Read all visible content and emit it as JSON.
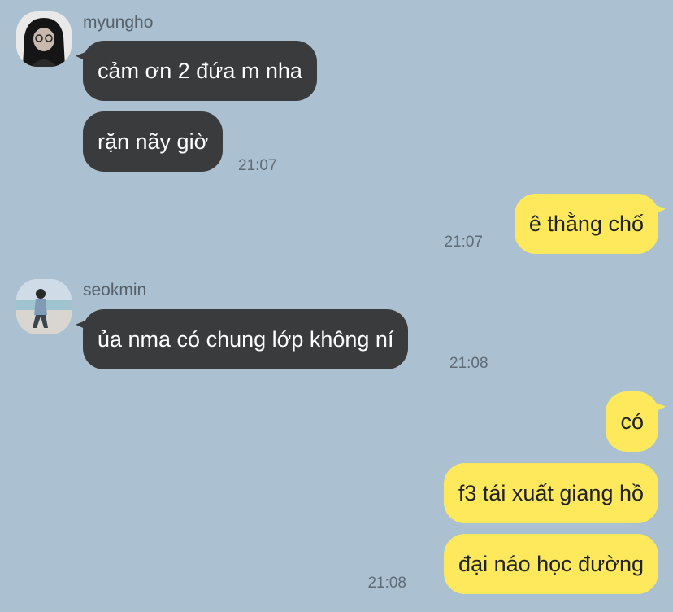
{
  "chat": {
    "messages": [
      {
        "sender": "myungho",
        "text": "cảm ơn 2 đứa m nha"
      },
      {
        "sender": "myungho",
        "text": "rặn nãy giờ",
        "time": "21:07"
      },
      {
        "sender": "me",
        "text": "ê thằng chố",
        "time": "21:07"
      },
      {
        "sender": "seokmin",
        "text": "ủa nma có chung lớp không ní",
        "time": "21:08"
      },
      {
        "sender": "me",
        "text": "có"
      },
      {
        "sender": "me",
        "text": "f3 tái xuất giang hồ"
      },
      {
        "sender": "me",
        "text": "đại náo học đường",
        "time": "21:08"
      }
    ]
  },
  "colors": {
    "background": "#abc1d1",
    "incoming_bubble": "#3a3b3d",
    "outgoing_bubble": "#fde95b"
  }
}
